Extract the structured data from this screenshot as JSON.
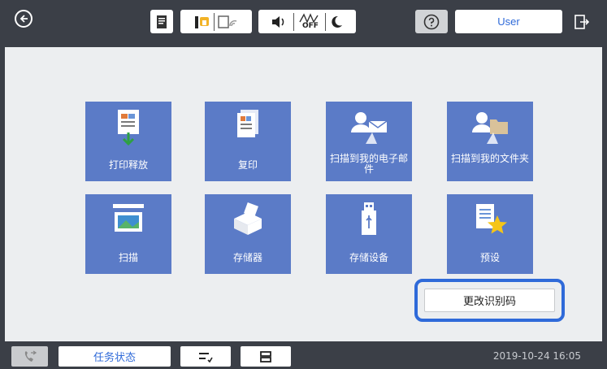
{
  "topbar": {
    "user_label": "User",
    "icons": [
      "back-arrow-icon",
      "document-info-icon",
      "ink-status-icon",
      "wifi-icon",
      "volume-icon",
      "power-save-off-icon",
      "sleep-icon",
      "help-icon",
      "logout-icon"
    ],
    "power_save_off": "OFF"
  },
  "tiles": [
    {
      "label": "打印释放",
      "icon": "print-release-icon"
    },
    {
      "label": "复印",
      "icon": "copy-icon"
    },
    {
      "label": "扫描到我的电子邮件",
      "icon": "scan-to-email-icon"
    },
    {
      "label": "扫描到我的文件夹",
      "icon": "scan-to-folder-icon"
    },
    {
      "label": "扫描",
      "icon": "scan-icon"
    },
    {
      "label": "存储器",
      "icon": "storage-icon"
    },
    {
      "label": "存储设备",
      "icon": "storage-device-icon"
    },
    {
      "label": "预设",
      "icon": "presets-icon"
    }
  ],
  "change_code_button": "更改识别码",
  "bottombar": {
    "fax_icon": "fax-icon",
    "job_status_label": "任务状态",
    "datetime": "2019-10-24 16:05"
  },
  "colors": {
    "tile": "#5b7bc7",
    "accent": "#2f6ad9",
    "bar": "#3b3f47",
    "background": "#eceef0"
  }
}
